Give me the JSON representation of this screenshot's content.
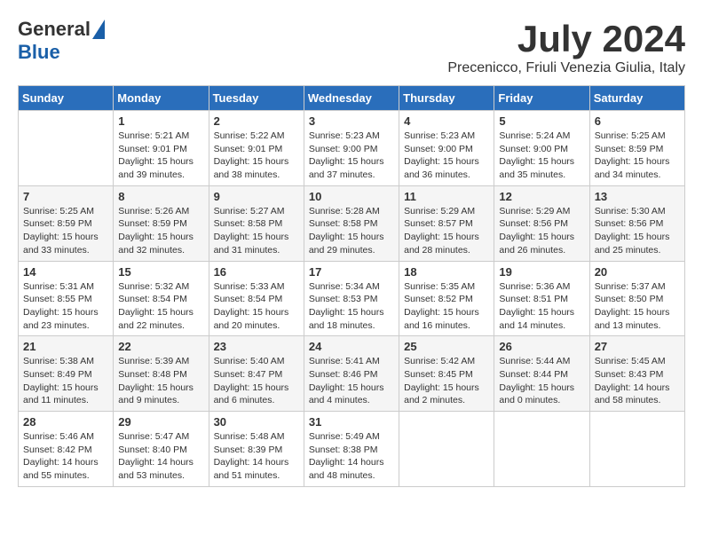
{
  "header": {
    "logo_general": "General",
    "logo_blue": "Blue",
    "month_title": "July 2024",
    "location": "Precenicco, Friuli Venezia Giulia, Italy"
  },
  "weekdays": [
    "Sunday",
    "Monday",
    "Tuesday",
    "Wednesday",
    "Thursday",
    "Friday",
    "Saturday"
  ],
  "weeks": [
    [
      {
        "day": "",
        "text": ""
      },
      {
        "day": "1",
        "text": "Sunrise: 5:21 AM\nSunset: 9:01 PM\nDaylight: 15 hours\nand 39 minutes."
      },
      {
        "day": "2",
        "text": "Sunrise: 5:22 AM\nSunset: 9:01 PM\nDaylight: 15 hours\nand 38 minutes."
      },
      {
        "day": "3",
        "text": "Sunrise: 5:23 AM\nSunset: 9:00 PM\nDaylight: 15 hours\nand 37 minutes."
      },
      {
        "day": "4",
        "text": "Sunrise: 5:23 AM\nSunset: 9:00 PM\nDaylight: 15 hours\nand 36 minutes."
      },
      {
        "day": "5",
        "text": "Sunrise: 5:24 AM\nSunset: 9:00 PM\nDaylight: 15 hours\nand 35 minutes."
      },
      {
        "day": "6",
        "text": "Sunrise: 5:25 AM\nSunset: 8:59 PM\nDaylight: 15 hours\nand 34 minutes."
      }
    ],
    [
      {
        "day": "7",
        "text": "Sunrise: 5:25 AM\nSunset: 8:59 PM\nDaylight: 15 hours\nand 33 minutes."
      },
      {
        "day": "8",
        "text": "Sunrise: 5:26 AM\nSunset: 8:59 PM\nDaylight: 15 hours\nand 32 minutes."
      },
      {
        "day": "9",
        "text": "Sunrise: 5:27 AM\nSunset: 8:58 PM\nDaylight: 15 hours\nand 31 minutes."
      },
      {
        "day": "10",
        "text": "Sunrise: 5:28 AM\nSunset: 8:58 PM\nDaylight: 15 hours\nand 29 minutes."
      },
      {
        "day": "11",
        "text": "Sunrise: 5:29 AM\nSunset: 8:57 PM\nDaylight: 15 hours\nand 28 minutes."
      },
      {
        "day": "12",
        "text": "Sunrise: 5:29 AM\nSunset: 8:56 PM\nDaylight: 15 hours\nand 26 minutes."
      },
      {
        "day": "13",
        "text": "Sunrise: 5:30 AM\nSunset: 8:56 PM\nDaylight: 15 hours\nand 25 minutes."
      }
    ],
    [
      {
        "day": "14",
        "text": "Sunrise: 5:31 AM\nSunset: 8:55 PM\nDaylight: 15 hours\nand 23 minutes."
      },
      {
        "day": "15",
        "text": "Sunrise: 5:32 AM\nSunset: 8:54 PM\nDaylight: 15 hours\nand 22 minutes."
      },
      {
        "day": "16",
        "text": "Sunrise: 5:33 AM\nSunset: 8:54 PM\nDaylight: 15 hours\nand 20 minutes."
      },
      {
        "day": "17",
        "text": "Sunrise: 5:34 AM\nSunset: 8:53 PM\nDaylight: 15 hours\nand 18 minutes."
      },
      {
        "day": "18",
        "text": "Sunrise: 5:35 AM\nSunset: 8:52 PM\nDaylight: 15 hours\nand 16 minutes."
      },
      {
        "day": "19",
        "text": "Sunrise: 5:36 AM\nSunset: 8:51 PM\nDaylight: 15 hours\nand 14 minutes."
      },
      {
        "day": "20",
        "text": "Sunrise: 5:37 AM\nSunset: 8:50 PM\nDaylight: 15 hours\nand 13 minutes."
      }
    ],
    [
      {
        "day": "21",
        "text": "Sunrise: 5:38 AM\nSunset: 8:49 PM\nDaylight: 15 hours\nand 11 minutes."
      },
      {
        "day": "22",
        "text": "Sunrise: 5:39 AM\nSunset: 8:48 PM\nDaylight: 15 hours\nand 9 minutes."
      },
      {
        "day": "23",
        "text": "Sunrise: 5:40 AM\nSunset: 8:47 PM\nDaylight: 15 hours\nand 6 minutes."
      },
      {
        "day": "24",
        "text": "Sunrise: 5:41 AM\nSunset: 8:46 PM\nDaylight: 15 hours\nand 4 minutes."
      },
      {
        "day": "25",
        "text": "Sunrise: 5:42 AM\nSunset: 8:45 PM\nDaylight: 15 hours\nand 2 minutes."
      },
      {
        "day": "26",
        "text": "Sunrise: 5:44 AM\nSunset: 8:44 PM\nDaylight: 15 hours\nand 0 minutes."
      },
      {
        "day": "27",
        "text": "Sunrise: 5:45 AM\nSunset: 8:43 PM\nDaylight: 14 hours\nand 58 minutes."
      }
    ],
    [
      {
        "day": "28",
        "text": "Sunrise: 5:46 AM\nSunset: 8:42 PM\nDaylight: 14 hours\nand 55 minutes."
      },
      {
        "day": "29",
        "text": "Sunrise: 5:47 AM\nSunset: 8:40 PM\nDaylight: 14 hours\nand 53 minutes."
      },
      {
        "day": "30",
        "text": "Sunrise: 5:48 AM\nSunset: 8:39 PM\nDaylight: 14 hours\nand 51 minutes."
      },
      {
        "day": "31",
        "text": "Sunrise: 5:49 AM\nSunset: 8:38 PM\nDaylight: 14 hours\nand 48 minutes."
      },
      {
        "day": "",
        "text": ""
      },
      {
        "day": "",
        "text": ""
      },
      {
        "day": "",
        "text": ""
      }
    ]
  ]
}
